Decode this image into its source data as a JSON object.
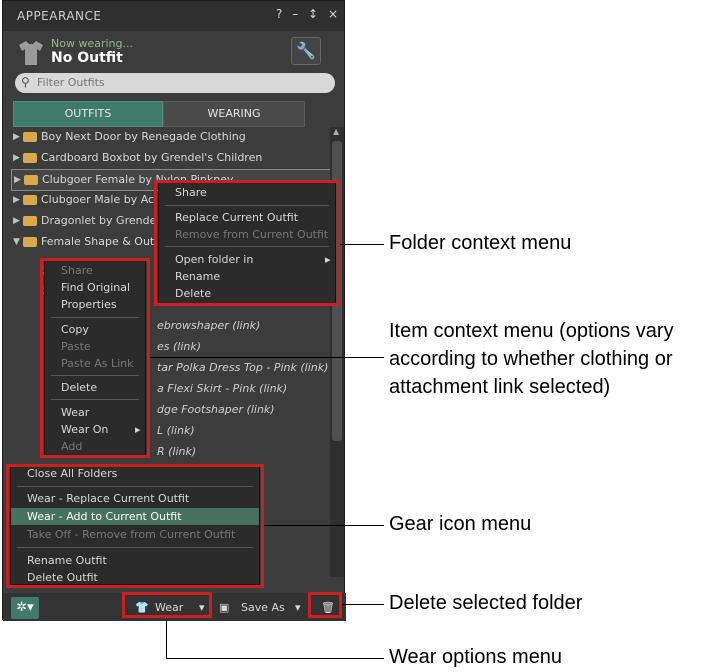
{
  "window": {
    "title": "APPEARANCE",
    "controls": [
      "?",
      "–",
      "↕",
      "×"
    ]
  },
  "header": {
    "now_wearing_label": "Now wearing...",
    "outfit_name": "No Outfit"
  },
  "search": {
    "placeholder": "Filter Outfits"
  },
  "tabs": [
    {
      "label": "OUTFITS"
    },
    {
      "label": "WEARING"
    }
  ],
  "folders": [
    {
      "label": "Boy Next Door by Renegade Clothing"
    },
    {
      "label": "Cardboard Boxbot by Grendel's Children"
    },
    {
      "label": "Clubgoer Female by Nylon Pinkney"
    },
    {
      "label": "Clubgoer Male by Ac"
    },
    {
      "label": "Dragonlet by Grende"
    },
    {
      "label": "Female Shape & Out"
    }
  ],
  "visible_items": [
    "ebrowshaper (link)",
    "es (link)",
    "tar Polka Dress Top - Pink (link)",
    "a Flexi Skirt - Pink (link)",
    "dge Footshaper (link)",
    "L (link)",
    "R (link)"
  ],
  "folder_menu": {
    "items": [
      {
        "label": "Share",
        "enabled": true
      },
      {
        "label": "Replace Current Outfit",
        "enabled": true
      },
      {
        "label": "Remove from Current Outfit",
        "enabled": false
      },
      {
        "label": "Open folder in",
        "enabled": true
      },
      {
        "label": "Rename",
        "enabled": true
      },
      {
        "label": "Delete",
        "enabled": true
      }
    ]
  },
  "item_menu": {
    "items": [
      {
        "label": "Share",
        "enabled": false
      },
      {
        "label": "Find Original",
        "enabled": true
      },
      {
        "label": "Properties",
        "enabled": true
      },
      {
        "label": "Copy",
        "enabled": true
      },
      {
        "label": "Paste",
        "enabled": false
      },
      {
        "label": "Paste As Link",
        "enabled": false
      },
      {
        "label": "Delete",
        "enabled": true
      },
      {
        "label": "Wear",
        "enabled": true
      },
      {
        "label": "Wear On",
        "enabled": true
      },
      {
        "label": "Add",
        "enabled": false
      }
    ]
  },
  "gear_menu": {
    "items": [
      {
        "label": "Close All Folders",
        "enabled": true
      },
      {
        "label": "Wear - Replace Current Outfit",
        "enabled": true
      },
      {
        "label": "Wear - Add to Current Outfit",
        "enabled": true,
        "highlighted": true
      },
      {
        "label": "Take Off - Remove from Current Outfit",
        "enabled": false
      },
      {
        "label": "Rename Outfit",
        "enabled": true
      },
      {
        "label": "Delete Outfit",
        "enabled": true
      }
    ]
  },
  "bottom_bar": {
    "wear_label": "Wear",
    "save_as_label": "Save As"
  },
  "callouts": {
    "folder_menu": "Folder context menu",
    "item_menu_1": "Item context menu (options vary",
    "item_menu_2": "according to whether clothing or",
    "item_menu_3": "attachment link selected)",
    "gear_menu": "Gear icon menu",
    "delete_folder": "Delete selected folder",
    "wear_options": "Wear options menu"
  },
  "colors": {
    "accent": "#3f7a6a",
    "annotation_red": "#cc1f1f",
    "folder": "#d9a94c"
  }
}
